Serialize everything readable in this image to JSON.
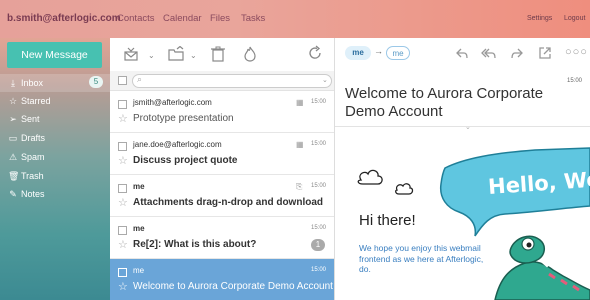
{
  "header": {
    "user_email": "b.smith@afterlogic.com",
    "nav": [
      "Contacts",
      "Calendar",
      "Files",
      "Tasks"
    ],
    "settings": "Settings",
    "logout": "Logout"
  },
  "sidebar": {
    "new_message": "New Message",
    "folders": [
      {
        "label": "Inbox",
        "icon": "inbox-icon",
        "count": "5",
        "active": true
      },
      {
        "label": "Starred",
        "icon": "star-icon"
      },
      {
        "label": "Sent",
        "icon": "send-icon"
      },
      {
        "label": "Drafts",
        "icon": "drafts-icon"
      },
      {
        "label": "Spam",
        "icon": "spam-icon"
      },
      {
        "label": "Trash",
        "icon": "trash-icon"
      },
      {
        "label": "Notes",
        "icon": "notes-icon"
      }
    ]
  },
  "messages": [
    {
      "from": "jsmith@afterlogic.com",
      "subject": "Prototype presentation",
      "time": "15:00",
      "bold": false
    },
    {
      "from": "jane.doe@afterlogic.com",
      "subject": "Discuss project quote",
      "time": "15:00",
      "bold": true
    },
    {
      "from": "me",
      "subject": "Attachments drag-n-drop and download",
      "time": "15:00",
      "bold": true
    },
    {
      "from": "me",
      "subject": "Re[2]: What is this about?",
      "time": "15:00",
      "bold": true,
      "count": "1"
    },
    {
      "from": "me",
      "subject": "Welcome to Aurora Corporate Demo Account",
      "time": "15:00",
      "bold": false,
      "selected": true
    }
  ],
  "viewer": {
    "from_chip": "me",
    "to_chip": "me",
    "time": "15:00",
    "subject": "Welcome to Aurora Corporate Demo Account",
    "greeting": "Hi there!",
    "blurb": "We hope you enjoy this webmail frontend as we here at Afterlogic, do.",
    "hello_banner": "Hello, World"
  },
  "colors": {
    "accent": "#47c1b1",
    "selected_row": "#6aa5d8",
    "dino": "#2fa88f",
    "banner": "#5fc6e0"
  }
}
